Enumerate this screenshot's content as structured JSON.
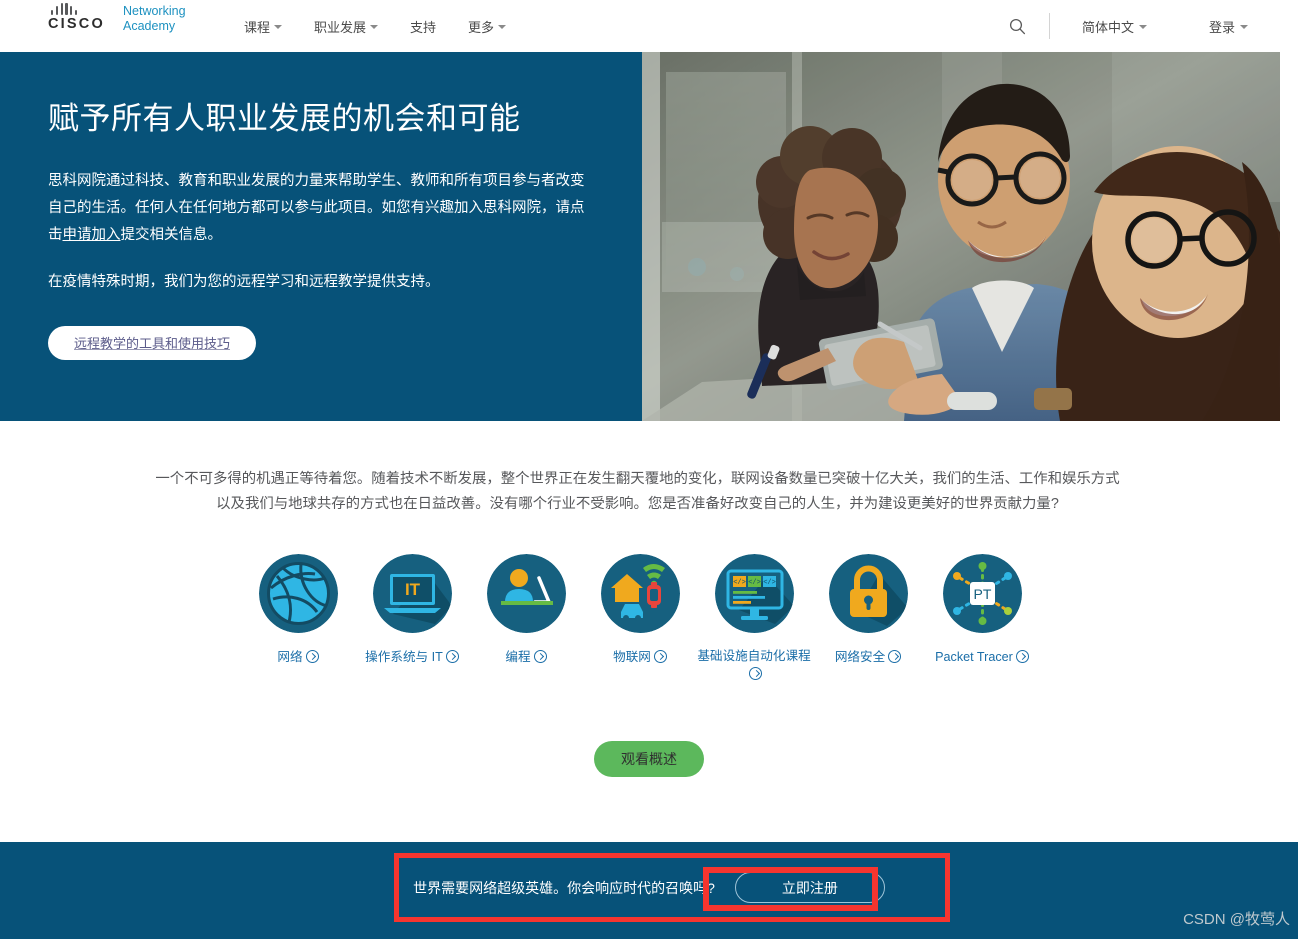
{
  "header": {
    "logo": {
      "brand": "CISCO",
      "product_line1": "Networking",
      "product_line2": "Academy"
    },
    "nav": [
      {
        "label": "课程",
        "has_caret": true
      },
      {
        "label": "职业发展",
        "has_caret": true
      },
      {
        "label": "支持",
        "has_caret": false
      },
      {
        "label": "更多",
        "has_caret": true
      }
    ],
    "search_icon": "search-icon",
    "language": {
      "label": "简体中文",
      "has_caret": true
    },
    "signin": {
      "label": "登录",
      "has_caret": true
    }
  },
  "hero": {
    "title": "赋予所有人职业发展的机会和可能",
    "paragraph_part1": "思科网院通过科技、教育和职业发展的力量来帮助学生、教师和所有项目参与者改变自己的生活。任何人在任何地方都可以参与此项目。如您有兴趣加入思科网院，请点击",
    "paragraph_link": "申请加入",
    "paragraph_part2": "提交相关信息。",
    "paragraph2": "在疫情特殊时期，我们为您的远程学习和远程教学提供支持。",
    "button_label": "远程教学的工具和使用技巧",
    "background_color": "#075279",
    "photo_alt": "three-students-with-tablet-photo"
  },
  "main": {
    "intro": "一个不可多得的机遇正等待着您。随着技术不断发展，整个世界正在发生翻天覆地的变化，联网设备数量已突破十亿大关，我们的生活、工作和娱乐方式以及我们与地球共存的方式也在日益改善。没有哪个行业不受影响。您是否准备好改变自己的人生，并为建设更美好的世界贡献力量?",
    "tiles": [
      {
        "label": "网络",
        "icon": "globe-network-icon"
      },
      {
        "label": "操作系统与 IT",
        "icon": "laptop-it-icon"
      },
      {
        "label": "编程",
        "icon": "person-coding-icon"
      },
      {
        "label": "物联网",
        "icon": "iot-home-car-icon"
      },
      {
        "label": "基础设施自动化课程",
        "icon": "monitor-code-icon"
      },
      {
        "label": "网络安全",
        "icon": "padlock-icon"
      },
      {
        "label": "Packet Tracer",
        "icon": "packet-tracer-icon"
      }
    ],
    "watch_button": "观看概述",
    "accent_green": "#5cb85c",
    "link_blue": "#1b6ea8"
  },
  "banner": {
    "text": "世界需要网络超级英雄。你会响应时代的召唤吗?",
    "button_label": "立即注册",
    "background_color": "#075279",
    "highlight_color": "#f6352f"
  },
  "watermark": "CSDN @牧莺人"
}
